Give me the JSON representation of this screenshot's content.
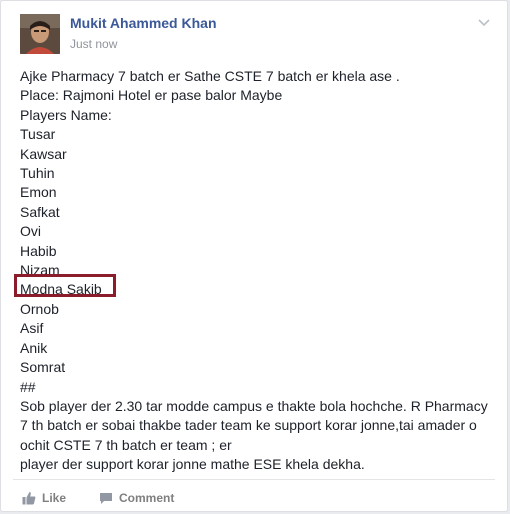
{
  "post": {
    "author": "Mukit Ahammed Khan",
    "timestamp": "Just now",
    "lines": [
      "Ajke Pharmacy 7 batch er Sathe CSTE 7 batch er khela ase .",
      "Place: Rajmoni Hotel er pase balor Maybe",
      "Players Name:",
      "Tusar",
      "Kawsar",
      "Tuhin",
      "Emon",
      "Safkat",
      "Ovi",
      "Habib",
      "Nizam",
      "Modna Sakib",
      "Ornob",
      "Asif",
      "Anik",
      "Somrat",
      "##"
    ],
    "paragraph": "Sob player der 2.30 tar modde campus e thakte bola hochche. R Pharmacy 7 th batch er sobai thakbe tader team ke support korar jonne,tai amader o ochit CSTE 7 th batch er team ; er",
    "last_line": "player der support korar jonne mathe ESE khela dekha."
  },
  "actions": {
    "like_label": "Like",
    "comment_label": "Comment"
  },
  "icons": {
    "menu": "chevron-down-icon",
    "like": "thumbs-up-icon",
    "comment": "comment-bubble-icon"
  },
  "colors": {
    "author_link": "#3b5998",
    "highlight_border": "#8b1c2c",
    "action_text": "#7f7f7f"
  }
}
